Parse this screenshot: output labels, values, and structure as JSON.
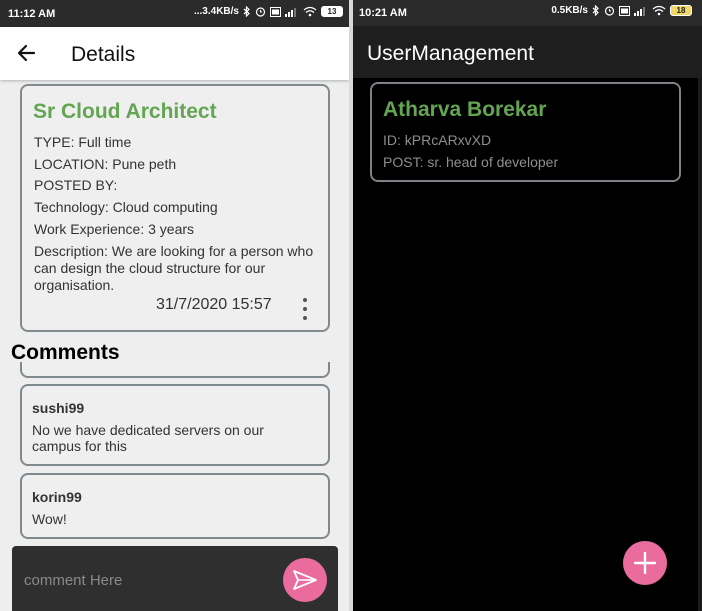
{
  "left_screen": {
    "status_bar": {
      "time": "11:12 AM",
      "speed": "...3.4KB/s",
      "battery": "13",
      "icons": [
        "bluetooth-icon",
        "alarm-icon",
        "volte-icon",
        "signal-icon",
        "wifi-icon",
        "battery-icon"
      ]
    },
    "app_bar": {
      "title": "Details",
      "back_icon": "arrow-left-icon"
    },
    "job": {
      "title": "Sr Cloud Architect",
      "type": "TYPE: Full time",
      "location": "LOCATION: Pune peth",
      "posted_by": "POSTED BY:",
      "technology": "Technology: Cloud computing",
      "experience": "Work Experience: 3 years",
      "description": "Description: We are looking for a person who can design the cloud structure for our organisation.",
      "date": "31/7/2020 15:57",
      "menu_icon": "more-vert-icon"
    },
    "comments_heading": "Comments",
    "comments": [
      {
        "user": "sushi99",
        "text": "No we have dedicated servers on our campus for this"
      },
      {
        "user": "korin99",
        "text": "Wow!"
      }
    ],
    "comment_input": {
      "placeholder": "comment Here",
      "value": ""
    },
    "send_icon": "send-icon"
  },
  "right_screen": {
    "status_bar": {
      "time": "10:21 AM",
      "speed": "0.5KB/s",
      "battery": "18",
      "icons": [
        "bluetooth-icon",
        "alarm-icon",
        "volte-icon",
        "signal-icon",
        "wifi-icon",
        "battery-icon"
      ]
    },
    "app_bar": {
      "title": "UserManagement"
    },
    "user": {
      "name": "Atharva Borekar",
      "id": "ID: kPRcARxvXD",
      "post": "POST: sr. head of developer"
    },
    "fab_icon": "plus-icon"
  },
  "colors": {
    "accent_green": "#63a552",
    "fab_pink": "#ea6c9f",
    "card_border": "#7f8a8f"
  }
}
